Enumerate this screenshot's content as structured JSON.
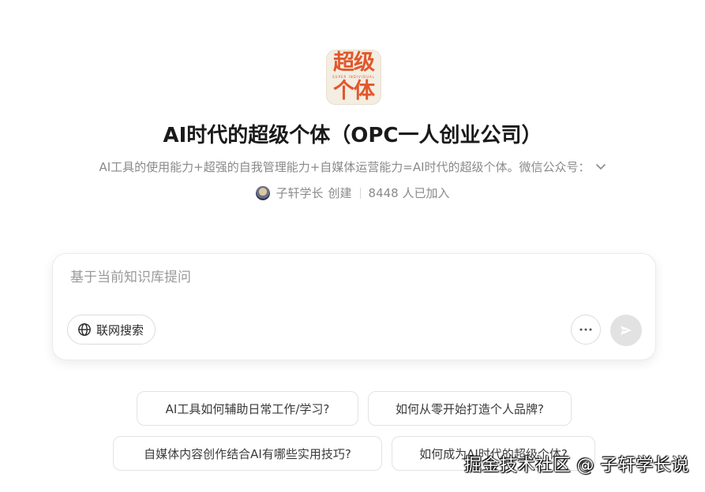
{
  "logo": {
    "line1": "超级",
    "line2": "SUPER INDIVIDUAL",
    "line3": "个体",
    "accent": "#e2572b",
    "background": "#f3ede2"
  },
  "header": {
    "title": "AI时代的超级个体（OPC一人创业公司）",
    "description": "AI工具的使用能力+超强的自我管理能力+自媒体运营能力=AI时代的超级个体。微信公众号：",
    "expand_icon": "chevron-down-icon",
    "creator_name": "子轩学长",
    "created_label": "创建",
    "members_text": "8448 人已加入"
  },
  "composer": {
    "placeholder": "基于当前知识库提问",
    "value": "",
    "web_search_label": "联网搜索",
    "web_search_icon": "globe-icon",
    "more_icon": "ellipsis-icon",
    "send_icon": "send-icon"
  },
  "suggestions": [
    "AI工具如何辅助日常工作/学习?",
    "如何从零开始打造个人品牌?",
    "自媒体内容创作结合AI有哪些实用技巧?",
    "如何成为AI时代的超级个体?"
  ],
  "watermark": "掘金技术社区 @ 子轩学长说"
}
